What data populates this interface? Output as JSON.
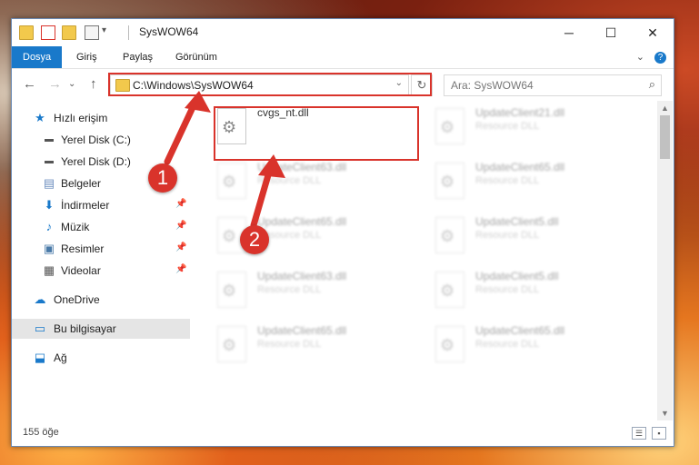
{
  "window": {
    "title": "SysWOW64",
    "minimize_glyph": "─",
    "maximize_glyph": "☐",
    "close_glyph": "✕"
  },
  "ribbon": {
    "tabs": [
      "Dosya",
      "Giriş",
      "Paylaş",
      "Görünüm"
    ],
    "collapse_glyph": "⌄",
    "help_glyph": "?"
  },
  "nav": {
    "back_glyph": "←",
    "forward_glyph": "→",
    "recent_glyph": "⌄",
    "up_glyph": "↑",
    "address_path": "C:\\Windows\\SysWOW64",
    "address_dropdown_glyph": "⌄",
    "refresh_glyph": "↻",
    "search_placeholder": "Ara: SysWOW64",
    "search_glyph": "⌕"
  },
  "sidebar": {
    "items": [
      {
        "label": "Hızlı erişim",
        "icon": "star-icon",
        "glyph": "★"
      },
      {
        "label": "Yerel Disk (C:)",
        "icon": "drive-icon",
        "glyph": "▬"
      },
      {
        "label": "Yerel Disk (D:)",
        "icon": "drive-icon",
        "glyph": "▬"
      },
      {
        "label": "Belgeler",
        "icon": "documents-icon",
        "glyph": "▤"
      },
      {
        "label": "İndirmeler",
        "icon": "download-icon",
        "glyph": "⬇"
      },
      {
        "label": "Müzik",
        "icon": "music-icon",
        "glyph": "♪"
      },
      {
        "label": "Resimler",
        "icon": "pictures-icon",
        "glyph": "▣"
      },
      {
        "label": "Videolar",
        "icon": "video-icon",
        "glyph": "▦"
      },
      {
        "label": "OneDrive",
        "icon": "cloud-icon",
        "glyph": "☁"
      },
      {
        "label": "Bu bilgisayar",
        "icon": "computer-icon",
        "glyph": "▭"
      },
      {
        "label": "Ağ",
        "icon": "network-icon",
        "glyph": "⬓"
      }
    ],
    "pin_glyph": "📌"
  },
  "files": [
    {
      "name": "cvgs_nt.dll",
      "type": ""
    },
    {
      "name": "UpdateClient21.dll",
      "type": "Resource DLL"
    },
    {
      "name": "UpdateClient63.dll",
      "type": "Resource DLL"
    },
    {
      "name": "UpdateClient65.dll",
      "type": "Resource DLL"
    },
    {
      "name": "UpdateClient65.dll",
      "type": "Resource DLL"
    },
    {
      "name": "UpdateClient5.dll",
      "type": "Resource DLL"
    },
    {
      "name": "UpdateClient63.dll",
      "type": "Resource DLL"
    },
    {
      "name": "UpdateClient5.dll",
      "type": "Resource DLL"
    },
    {
      "name": "UpdateClient65.dll",
      "type": "Resource DLL"
    },
    {
      "name": "UpdateClient65.dll",
      "type": "Resource DLL"
    }
  ],
  "callouts": {
    "one": "1",
    "two": "2"
  },
  "status": {
    "count": "155 öğe",
    "details_view_glyph": "☰",
    "large_icons_glyph": "▪"
  },
  "scrollbar": {
    "up_glyph": "▲",
    "down_glyph": "▼"
  },
  "colors": {
    "accent": "#1979ca",
    "highlight": "#d9332b"
  }
}
